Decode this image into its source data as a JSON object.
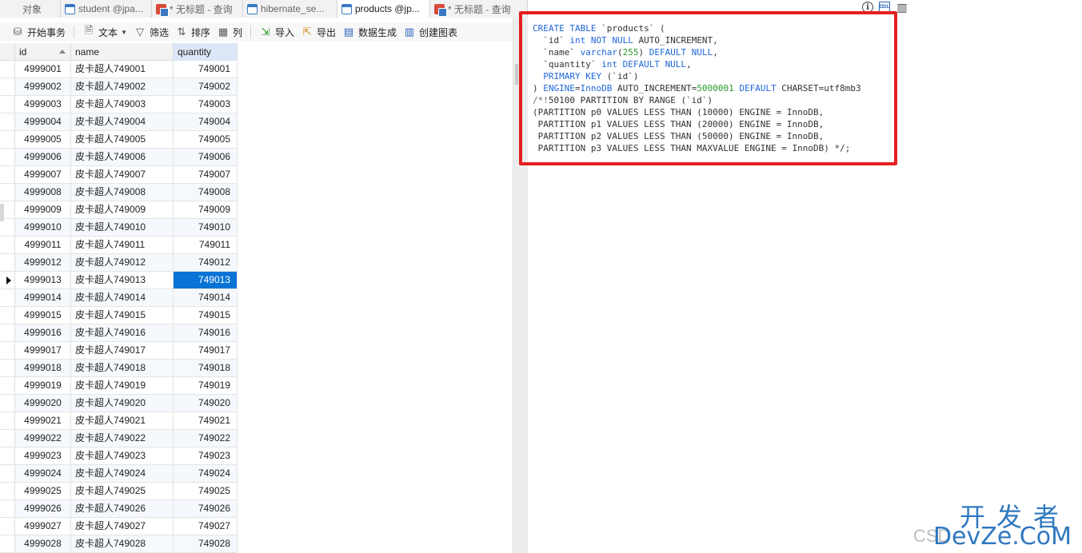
{
  "tabs": [
    {
      "label": "对象",
      "icon": "none",
      "active": false
    },
    {
      "label": "student @jpa...",
      "icon": "table-icon",
      "active": false
    },
    {
      "label": "* 无标题 - 查询",
      "icon": "query-icon",
      "active": false
    },
    {
      "label": "hibernate_se...",
      "icon": "table-icon",
      "active": false
    },
    {
      "label": "products @jp...",
      "icon": "table-icon",
      "active": true
    },
    {
      "label": "* 无标题 - 查询",
      "icon": "query-icon",
      "active": false
    }
  ],
  "toolbar": {
    "begin_txn": "开始事务",
    "text": "文本",
    "filter": "筛选",
    "sort": "排序",
    "columns": "列",
    "import": "导入",
    "export": "导出",
    "data_gen": "数据生成",
    "create_chart": "创建图表"
  },
  "grid": {
    "columns": [
      "id",
      "name",
      "quantity"
    ],
    "selected_row_id": "4999013",
    "rows": [
      {
        "id": "4999001",
        "name": "皮卡超人749001",
        "quantity": "749001"
      },
      {
        "id": "4999002",
        "name": "皮卡超人749002",
        "quantity": "749002"
      },
      {
        "id": "4999003",
        "name": "皮卡超人749003",
        "quantity": "749003"
      },
      {
        "id": "4999004",
        "name": "皮卡超人749004",
        "quantity": "749004"
      },
      {
        "id": "4999005",
        "name": "皮卡超人749005",
        "quantity": "749005"
      },
      {
        "id": "4999006",
        "name": "皮卡超人749006",
        "quantity": "749006"
      },
      {
        "id": "4999007",
        "name": "皮卡超人749007",
        "quantity": "749007"
      },
      {
        "id": "4999008",
        "name": "皮卡超人749008",
        "quantity": "749008"
      },
      {
        "id": "4999009",
        "name": "皮卡超人749009",
        "quantity": "749009"
      },
      {
        "id": "4999010",
        "name": "皮卡超人749010",
        "quantity": "749010"
      },
      {
        "id": "4999011",
        "name": "皮卡超人749011",
        "quantity": "749011"
      },
      {
        "id": "4999012",
        "name": "皮卡超人749012",
        "quantity": "749012"
      },
      {
        "id": "4999013",
        "name": "皮卡超人749013",
        "quantity": "749013"
      },
      {
        "id": "4999014",
        "name": "皮卡超人749014",
        "quantity": "749014"
      },
      {
        "id": "4999015",
        "name": "皮卡超人749015",
        "quantity": "749015"
      },
      {
        "id": "4999016",
        "name": "皮卡超人749016",
        "quantity": "749016"
      },
      {
        "id": "4999017",
        "name": "皮卡超人749017",
        "quantity": "749017"
      },
      {
        "id": "4999018",
        "name": "皮卡超人749018",
        "quantity": "749018"
      },
      {
        "id": "4999019",
        "name": "皮卡超人749019",
        "quantity": "749019"
      },
      {
        "id": "4999020",
        "name": "皮卡超人749020",
        "quantity": "749020"
      },
      {
        "id": "4999021",
        "name": "皮卡超人749021",
        "quantity": "749021"
      },
      {
        "id": "4999022",
        "name": "皮卡超人749022",
        "quantity": "749022"
      },
      {
        "id": "4999023",
        "name": "皮卡超人749023",
        "quantity": "749023"
      },
      {
        "id": "4999024",
        "name": "皮卡超人749024",
        "quantity": "749024"
      },
      {
        "id": "4999025",
        "name": "皮卡超人749025",
        "quantity": "749025"
      },
      {
        "id": "4999026",
        "name": "皮卡超人749026",
        "quantity": "749026"
      },
      {
        "id": "4999027",
        "name": "皮卡超人749027",
        "quantity": "749027"
      },
      {
        "id": "4999028",
        "name": "皮卡超人749028",
        "quantity": "749028"
      }
    ]
  },
  "ddl": {
    "lines": [
      [
        [
          "kw",
          "CREATE TABLE"
        ],
        [
          "t",
          " `products` ("
        ]
      ],
      [
        [
          "t",
          "  `id` "
        ],
        [
          "kw",
          "int NOT NULL"
        ],
        [
          "t",
          " AUTO_INCREMENT,"
        ]
      ],
      [
        [
          "t",
          "  `name` "
        ],
        [
          "kw",
          "varchar"
        ],
        [
          "t",
          "("
        ],
        [
          "num",
          "255"
        ],
        [
          "t",
          ") "
        ],
        [
          "kw",
          "DEFAULT NULL"
        ],
        [
          "t",
          ","
        ]
      ],
      [
        [
          "t",
          "  `quantity` "
        ],
        [
          "kw",
          "int DEFAULT NULL"
        ],
        [
          "t",
          ","
        ]
      ],
      [
        [
          "kw",
          "  PRIMARY KEY"
        ],
        [
          "t",
          " (`id`)"
        ]
      ],
      [
        [
          "t",
          ") "
        ],
        [
          "kw",
          "ENGINE"
        ],
        [
          "t",
          "="
        ],
        [
          "kw",
          "InnoDB"
        ],
        [
          "t",
          " AUTO_INCREMENT="
        ],
        [
          "num",
          "5000001"
        ],
        [
          "t",
          " "
        ],
        [
          "kw",
          "DEFAULT"
        ],
        [
          "t",
          " CHARSET=utf8mb3"
        ]
      ],
      [
        [
          "cm",
          "/*!"
        ],
        [
          "t",
          "50100 PARTITION BY RANGE (`id`)"
        ]
      ],
      [
        [
          "t",
          "(PARTITION p0 VALUES LESS THAN (10000) ENGINE = InnoDB,"
        ]
      ],
      [
        [
          "t",
          " PARTITION p1 VALUES LESS THAN (20000) ENGINE = InnoDB,"
        ]
      ],
      [
        [
          "t",
          " PARTITION p2 VALUES LESS THAN (50000) ENGINE = InnoDB,"
        ]
      ],
      [
        [
          "t",
          " PARTITION p3 VALUES LESS THAN MAXVALUE ENGINE = InnoDB) */;"
        ]
      ]
    ]
  },
  "right_icons": {
    "info": "i",
    "ddl": "DDL",
    "layout": "▥"
  },
  "watermark": {
    "cn": "开发者",
    "en": "DevZe.CoM",
    "csdn": "CSD"
  },
  "colors": {
    "selection": "#0a74d6",
    "highlight_box": "#e52020",
    "keyword": "#1f67d6",
    "number": "#2a9a2a"
  }
}
